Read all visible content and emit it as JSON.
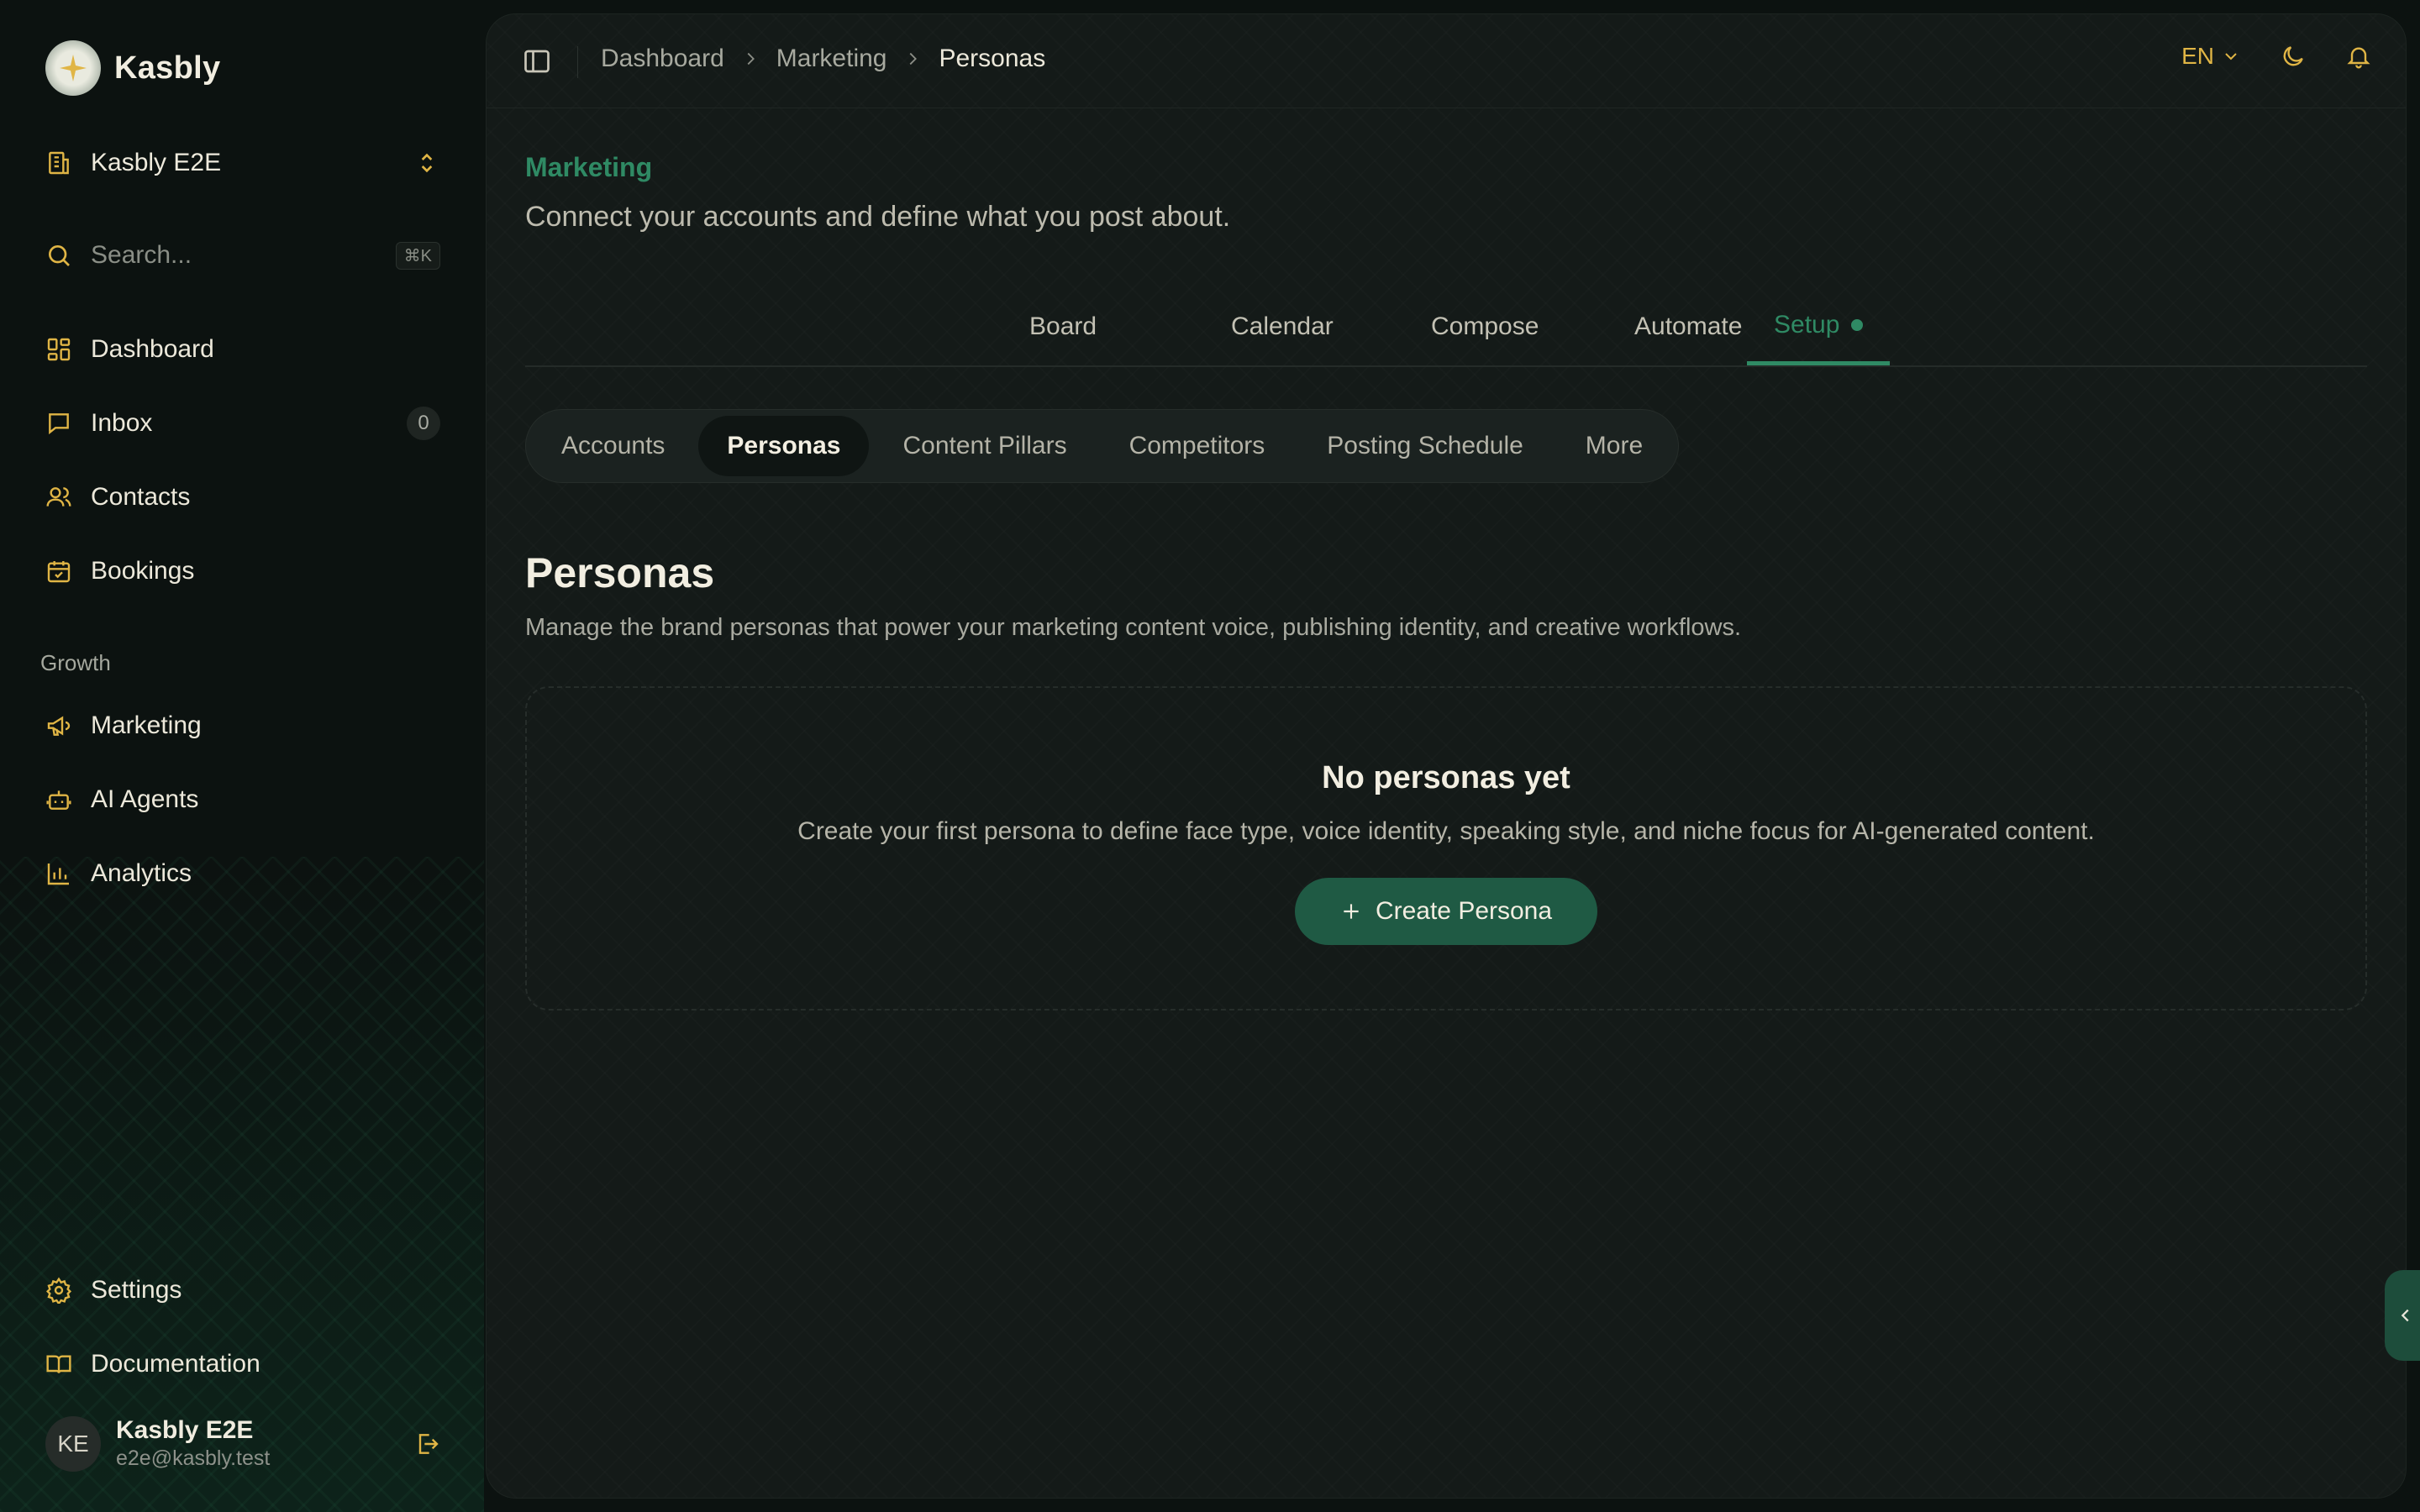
{
  "brand": {
    "name": "Kasbly"
  },
  "workspace": {
    "name": "Kasbly E2E"
  },
  "search": {
    "placeholder": "Search...",
    "shortcut": "⌘K"
  },
  "sidebar": {
    "items": [
      {
        "label": "Dashboard",
        "icon": "dashboard-icon"
      },
      {
        "label": "Inbox",
        "icon": "inbox-icon",
        "count": "0"
      },
      {
        "label": "Contacts",
        "icon": "contacts-icon"
      },
      {
        "label": "Bookings",
        "icon": "calendar-check-icon"
      }
    ],
    "section_label": "Growth",
    "growth_items": [
      {
        "label": "Marketing",
        "icon": "megaphone-icon"
      },
      {
        "label": "AI Agents",
        "icon": "bot-icon"
      },
      {
        "label": "Analytics",
        "icon": "bar-chart-icon"
      }
    ],
    "bottom_items": [
      {
        "label": "Settings",
        "icon": "gear-icon"
      },
      {
        "label": "Documentation",
        "icon": "book-icon"
      }
    ]
  },
  "user": {
    "initials": "KE",
    "name": "Kasbly E2E",
    "email": "e2e@kasbly.test"
  },
  "breadcrumb": [
    "Dashboard",
    "Marketing",
    "Personas"
  ],
  "topbar": {
    "language": "EN"
  },
  "page": {
    "eyebrow": "Marketing",
    "subtitle": "Connect your accounts and define what you post about."
  },
  "tabs": [
    "Board",
    "Calendar",
    "Compose",
    "Automate",
    "Setup"
  ],
  "active_tab": "Setup",
  "subtabs": [
    "Accounts",
    "Personas",
    "Content Pillars",
    "Competitors",
    "Posting Schedule",
    "More"
  ],
  "active_subtab": "Personas",
  "section": {
    "title": "Personas",
    "description": "Manage the brand personas that power your marketing content voice, publishing identity, and creative workflows."
  },
  "empty_state": {
    "title": "No personas yet",
    "description": "Create your first persona to define face type, voice identity, speaking style, and niche focus for AI-generated content.",
    "button": "Create Persona"
  },
  "colors": {
    "accent": "#2f8a64",
    "icon": "#e0b545",
    "button_bg": "#1f5a44",
    "background": "#0c1210"
  }
}
